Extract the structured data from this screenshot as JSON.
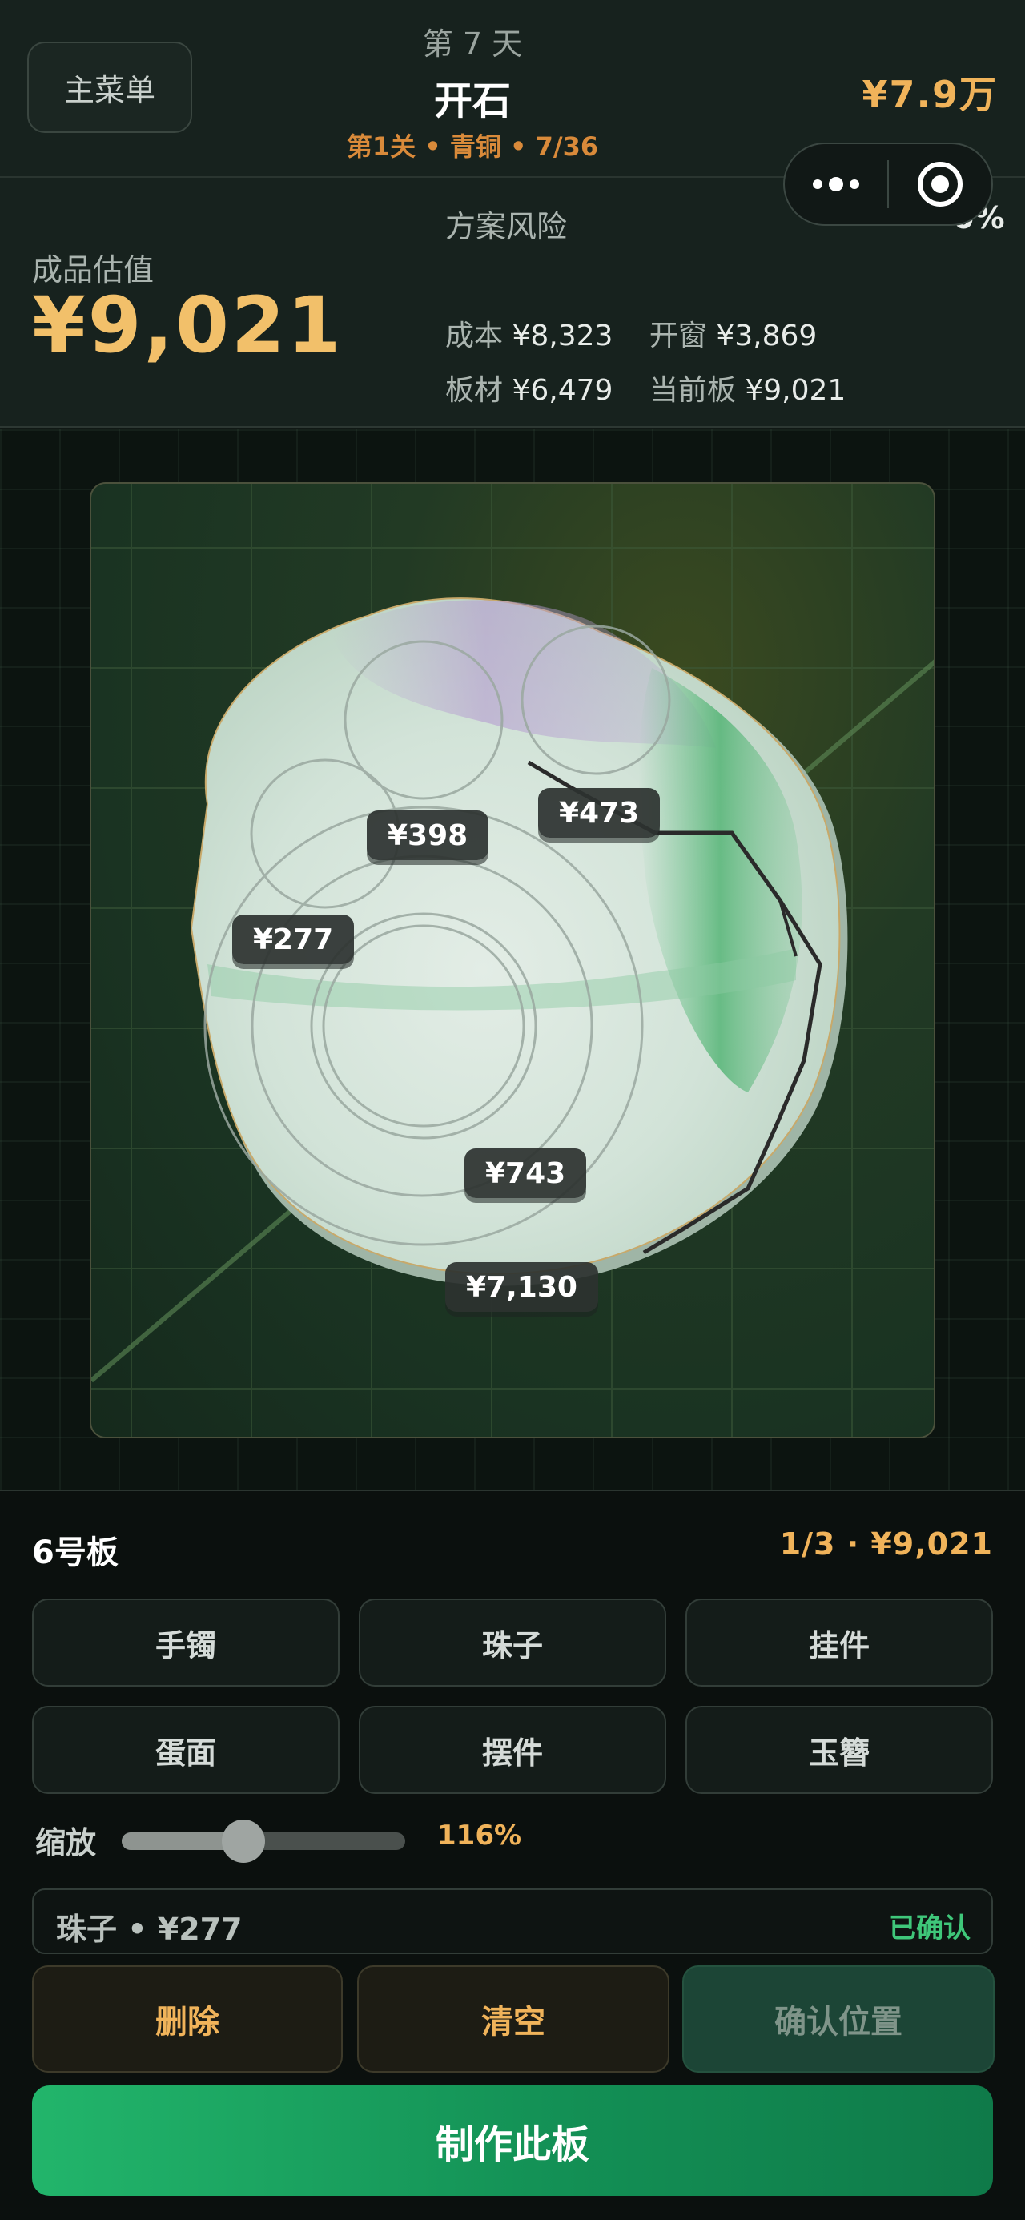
{
  "header": {
    "menu_label": "主菜单",
    "day": "第 7 天",
    "title": "开石",
    "subline": "第1关 • 青铜 • 7/36",
    "money": "¥7.9万",
    "capsule": {
      "more_icon": "more-dots-icon",
      "target_icon": "target-icon"
    }
  },
  "stats": {
    "estimate_label": "成品估值",
    "estimate_value": "¥9,021",
    "risk_label": "方案风险",
    "risk_percent": "0%",
    "cost_label": "成本",
    "cost_value": "¥8,323",
    "window_label": "开窗",
    "window_value": "¥3,869",
    "slab_label": "板材",
    "slab_value": "¥6,479",
    "current_label": "当前板",
    "current_value": "¥9,021"
  },
  "board": {
    "tags": [
      "¥398",
      "¥473",
      "¥277",
      "¥743",
      "¥7,130"
    ]
  },
  "panel": {
    "board_name": "6号板",
    "board_meta": "1/3 · ¥9,021",
    "types": [
      "手镯",
      "珠子",
      "挂件",
      "蛋面",
      "摆件",
      "玉簪"
    ],
    "zoom_label": "缩放",
    "zoom_value": "116%",
    "zoom_fraction": 0.43,
    "selection_text": "珠子 • ¥277",
    "selection_status": "已确认",
    "delete_label": "删除",
    "clear_label": "清空",
    "confirm_label": "确认位置",
    "make_label": "制作此板"
  },
  "colors": {
    "accent_gold": "#f0b35a",
    "accent_green": "#22b56b",
    "confirmed_green": "#3fc77a",
    "background": "#0b110e"
  }
}
